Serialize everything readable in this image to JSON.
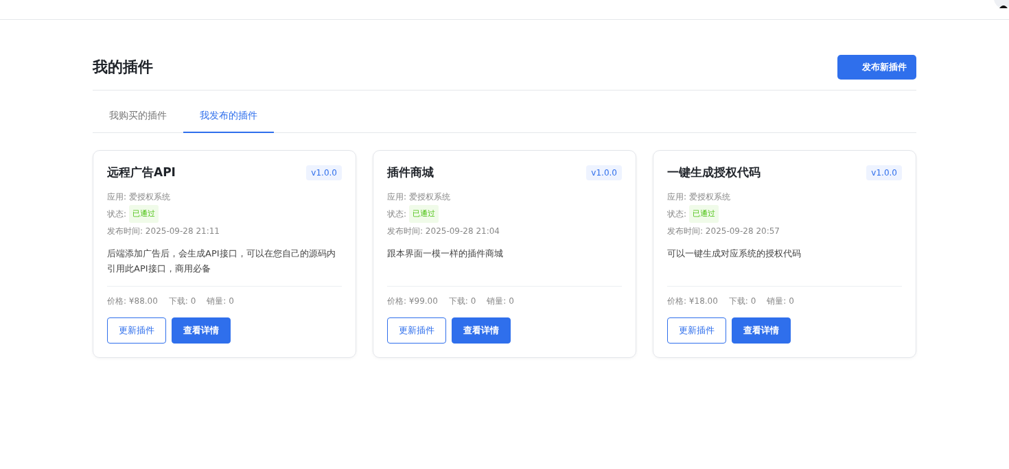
{
  "page_title": "我的插件",
  "publish_button": "发布新插件",
  "tabs": [
    {
      "label": "我购买的插件",
      "selected": false
    },
    {
      "label": "我发布的插件",
      "selected": true
    }
  ],
  "plugins": [
    {
      "name": "远程广告API",
      "version": "v1.0.0",
      "app": "应用: 爱授权系统",
      "status_label": "状态:",
      "status": {
        "text": "已通过",
        "kind": "approved"
      },
      "published": "发布时间: 2025-09-28 21:11",
      "description": "后端添加广告后，会生成API接口，可以在您自己的源码内引用此API接口，商用必备",
      "price": "价格: ¥88.00",
      "downloads": "下载: 0",
      "sales": "销量: 0",
      "buttons": [
        "更新插件",
        "查看详情"
      ]
    },
    {
      "name": "插件商城",
      "version": "v1.0.0",
      "app": "应用: 爱授权系统",
      "status_label": "状态:",
      "status": {
        "text": "已通过",
        "kind": "approved"
      },
      "published": "发布时间: 2025-09-28 21:04",
      "description": "跟本界面一模一样的插件商城",
      "price": "价格: ¥99.00",
      "downloads": "下载: 0",
      "sales": "销量: 0",
      "buttons": [
        "更新插件",
        "查看详情"
      ]
    },
    {
      "name": "一键生成授权代码",
      "version": "v1.0.0",
      "app": "应用: 爱授权系统",
      "status_label": "状态:",
      "status": {
        "text": "已通过",
        "kind": "approved"
      },
      "published": "发布时间: 2025-09-28 20:57",
      "description": "可以一键生成对应系统的授权代码",
      "price": "价格: ¥18.00",
      "downloads": "下载: 0",
      "sales": "销量: 0",
      "buttons": [
        "更新插件",
        "查看详情"
      ]
    }
  ]
}
